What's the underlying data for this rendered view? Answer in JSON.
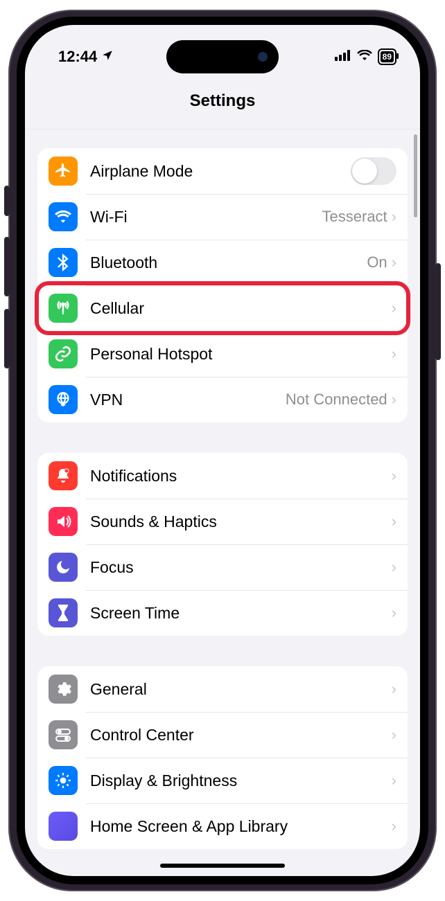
{
  "statusbar": {
    "time": "12:44",
    "battery_percent": "89"
  },
  "header": {
    "title": "Settings"
  },
  "groups": [
    {
      "rows": [
        {
          "key": "airplane",
          "label": "Airplane Mode",
          "type": "toggle",
          "toggle_on": false
        },
        {
          "key": "wifi",
          "label": "Wi-Fi",
          "detail": "Tesseract",
          "type": "link"
        },
        {
          "key": "bluetooth",
          "label": "Bluetooth",
          "detail": "On",
          "type": "link"
        },
        {
          "key": "cellular",
          "label": "Cellular",
          "type": "link",
          "highlighted": true
        },
        {
          "key": "hotspot",
          "label": "Personal Hotspot",
          "type": "link"
        },
        {
          "key": "vpn",
          "label": "VPN",
          "detail": "Not Connected",
          "type": "link"
        }
      ]
    },
    {
      "rows": [
        {
          "key": "notifications",
          "label": "Notifications",
          "type": "link"
        },
        {
          "key": "sounds",
          "label": "Sounds & Haptics",
          "type": "link"
        },
        {
          "key": "focus",
          "label": "Focus",
          "type": "link"
        },
        {
          "key": "screentime",
          "label": "Screen Time",
          "type": "link"
        }
      ]
    },
    {
      "rows": [
        {
          "key": "general",
          "label": "General",
          "type": "link"
        },
        {
          "key": "controlcenter",
          "label": "Control Center",
          "type": "link"
        },
        {
          "key": "display",
          "label": "Display & Brightness",
          "type": "link"
        },
        {
          "key": "homescreen",
          "label": "Home Screen & App Library",
          "type": "link"
        }
      ]
    }
  ],
  "colors": {
    "airplane": "#ff9500",
    "wifi": "#007aff",
    "bluetooth": "#007aff",
    "cellular": "#34c759",
    "hotspot": "#34c759",
    "vpn": "#007aff",
    "notifications": "#ff3b30",
    "sounds": "#ff2d55",
    "focus": "#5856d6",
    "screentime": "#5856d6",
    "general": "#8e8e93",
    "controlcenter": "#8e8e93",
    "display": "#007aff",
    "highlight": "#e7233a"
  }
}
